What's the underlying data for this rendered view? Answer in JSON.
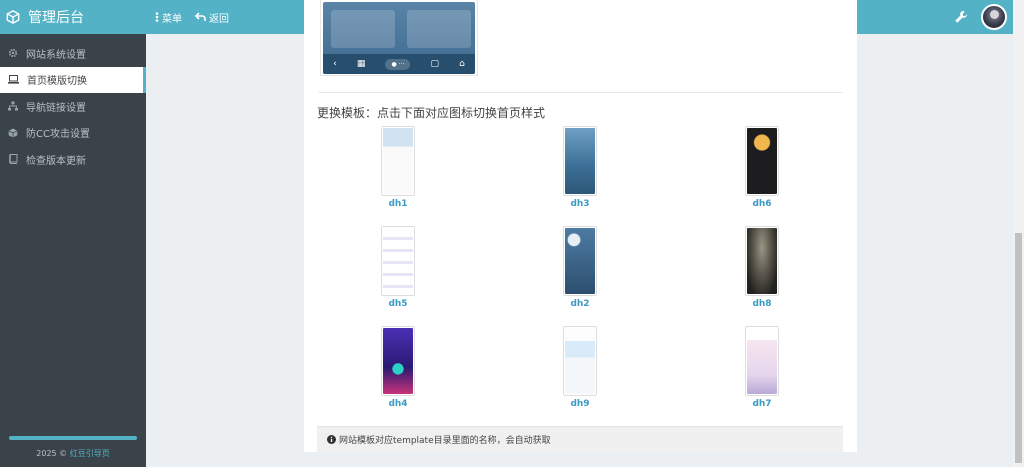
{
  "header": {
    "app_title": "管理后台",
    "menu_label": "菜单",
    "back_label": "返回"
  },
  "sidebar": {
    "items": [
      {
        "label": "网站系统设置",
        "icon": "gear-icon",
        "active": false
      },
      {
        "label": "首页模版切换",
        "icon": "laptop-icon",
        "active": true
      },
      {
        "label": "导航链接设置",
        "icon": "sitemap-icon",
        "active": false
      },
      {
        "label": "防CC攻击设置",
        "icon": "cube-icon",
        "active": false
      },
      {
        "label": "检查版本更新",
        "icon": "book-icon",
        "active": false
      }
    ],
    "footer_year": "2025 ©",
    "footer_link": "红豆引导页"
  },
  "main": {
    "section_label": "更换模板：点击下面对应图标切换首页样式",
    "templates": [
      {
        "name": "dh1"
      },
      {
        "name": "dh3"
      },
      {
        "name": "dh6"
      },
      {
        "name": "dh5"
      },
      {
        "name": "dh2"
      },
      {
        "name": "dh8"
      },
      {
        "name": "dh4"
      },
      {
        "name": "dh9"
      },
      {
        "name": "dh7"
      }
    ],
    "tip_text": "网站模板对应template目录里面的名称，会自动获取"
  },
  "colors": {
    "accent": "#53b2c6",
    "sidebar_bg": "#3a434a",
    "link": "#3a9bc4"
  }
}
